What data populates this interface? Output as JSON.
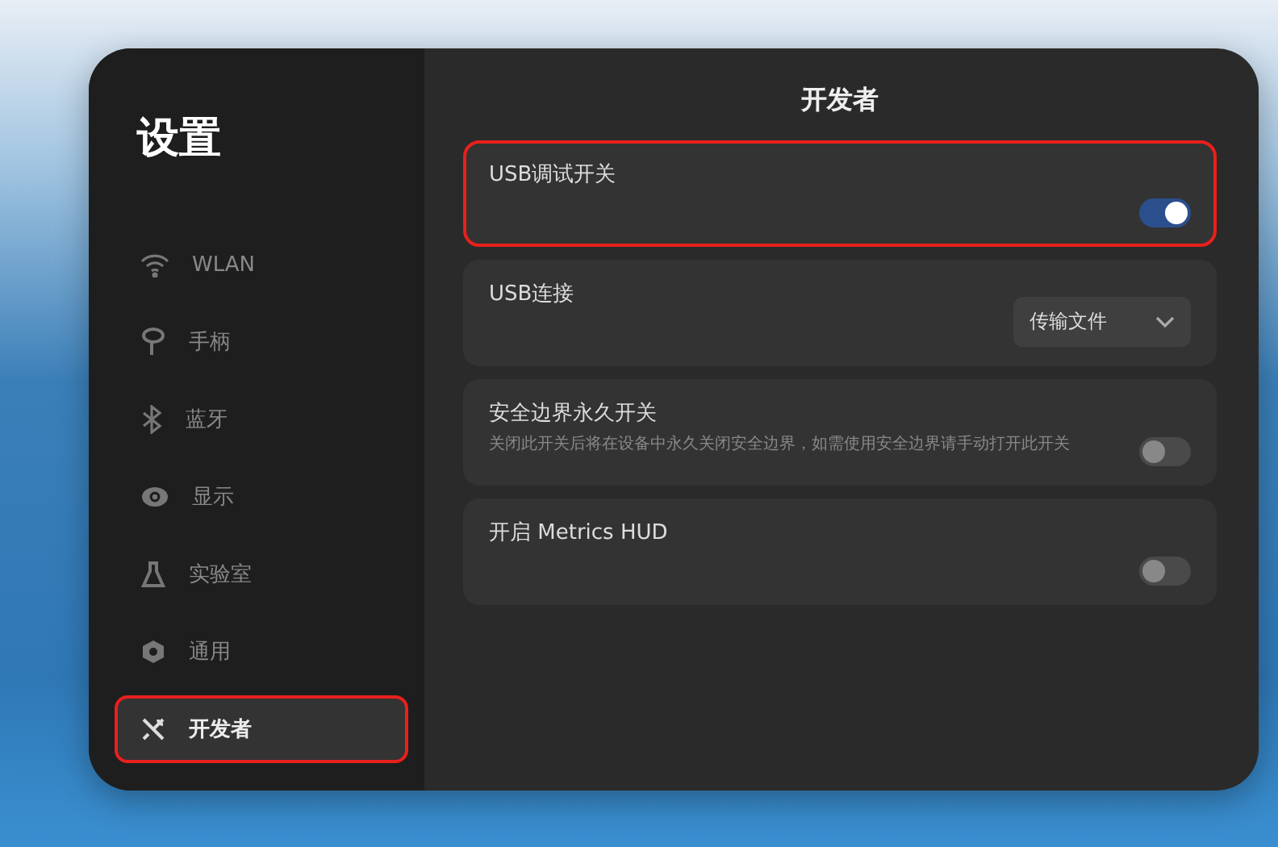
{
  "sidebar": {
    "title": "设置",
    "items": [
      {
        "label": "WLAN",
        "selected": false,
        "highlighted": false
      },
      {
        "label": "手柄",
        "selected": false,
        "highlighted": false
      },
      {
        "label": "蓝牙",
        "selected": false,
        "highlighted": false
      },
      {
        "label": "显示",
        "selected": false,
        "highlighted": false
      },
      {
        "label": "实验室",
        "selected": false,
        "highlighted": false
      },
      {
        "label": "通用",
        "selected": false,
        "highlighted": false
      },
      {
        "label": "开发者",
        "selected": true,
        "highlighted": true
      }
    ]
  },
  "page": {
    "title": "开发者",
    "rows": [
      {
        "kind": "toggle",
        "label": "USB调试开关",
        "on": true,
        "highlighted": true
      },
      {
        "kind": "dropdown",
        "label": "USB连接",
        "value": "传输文件",
        "highlighted": false
      },
      {
        "kind": "toggle",
        "label": "安全边界永久开关",
        "description": "关闭此开关后将在设备中永久关闭安全边界，如需使用安全边界请手动打开此开关",
        "on": false,
        "highlighted": false
      },
      {
        "kind": "toggle",
        "label": "开启 Metrics HUD",
        "on": false,
        "highlighted": false
      }
    ]
  }
}
